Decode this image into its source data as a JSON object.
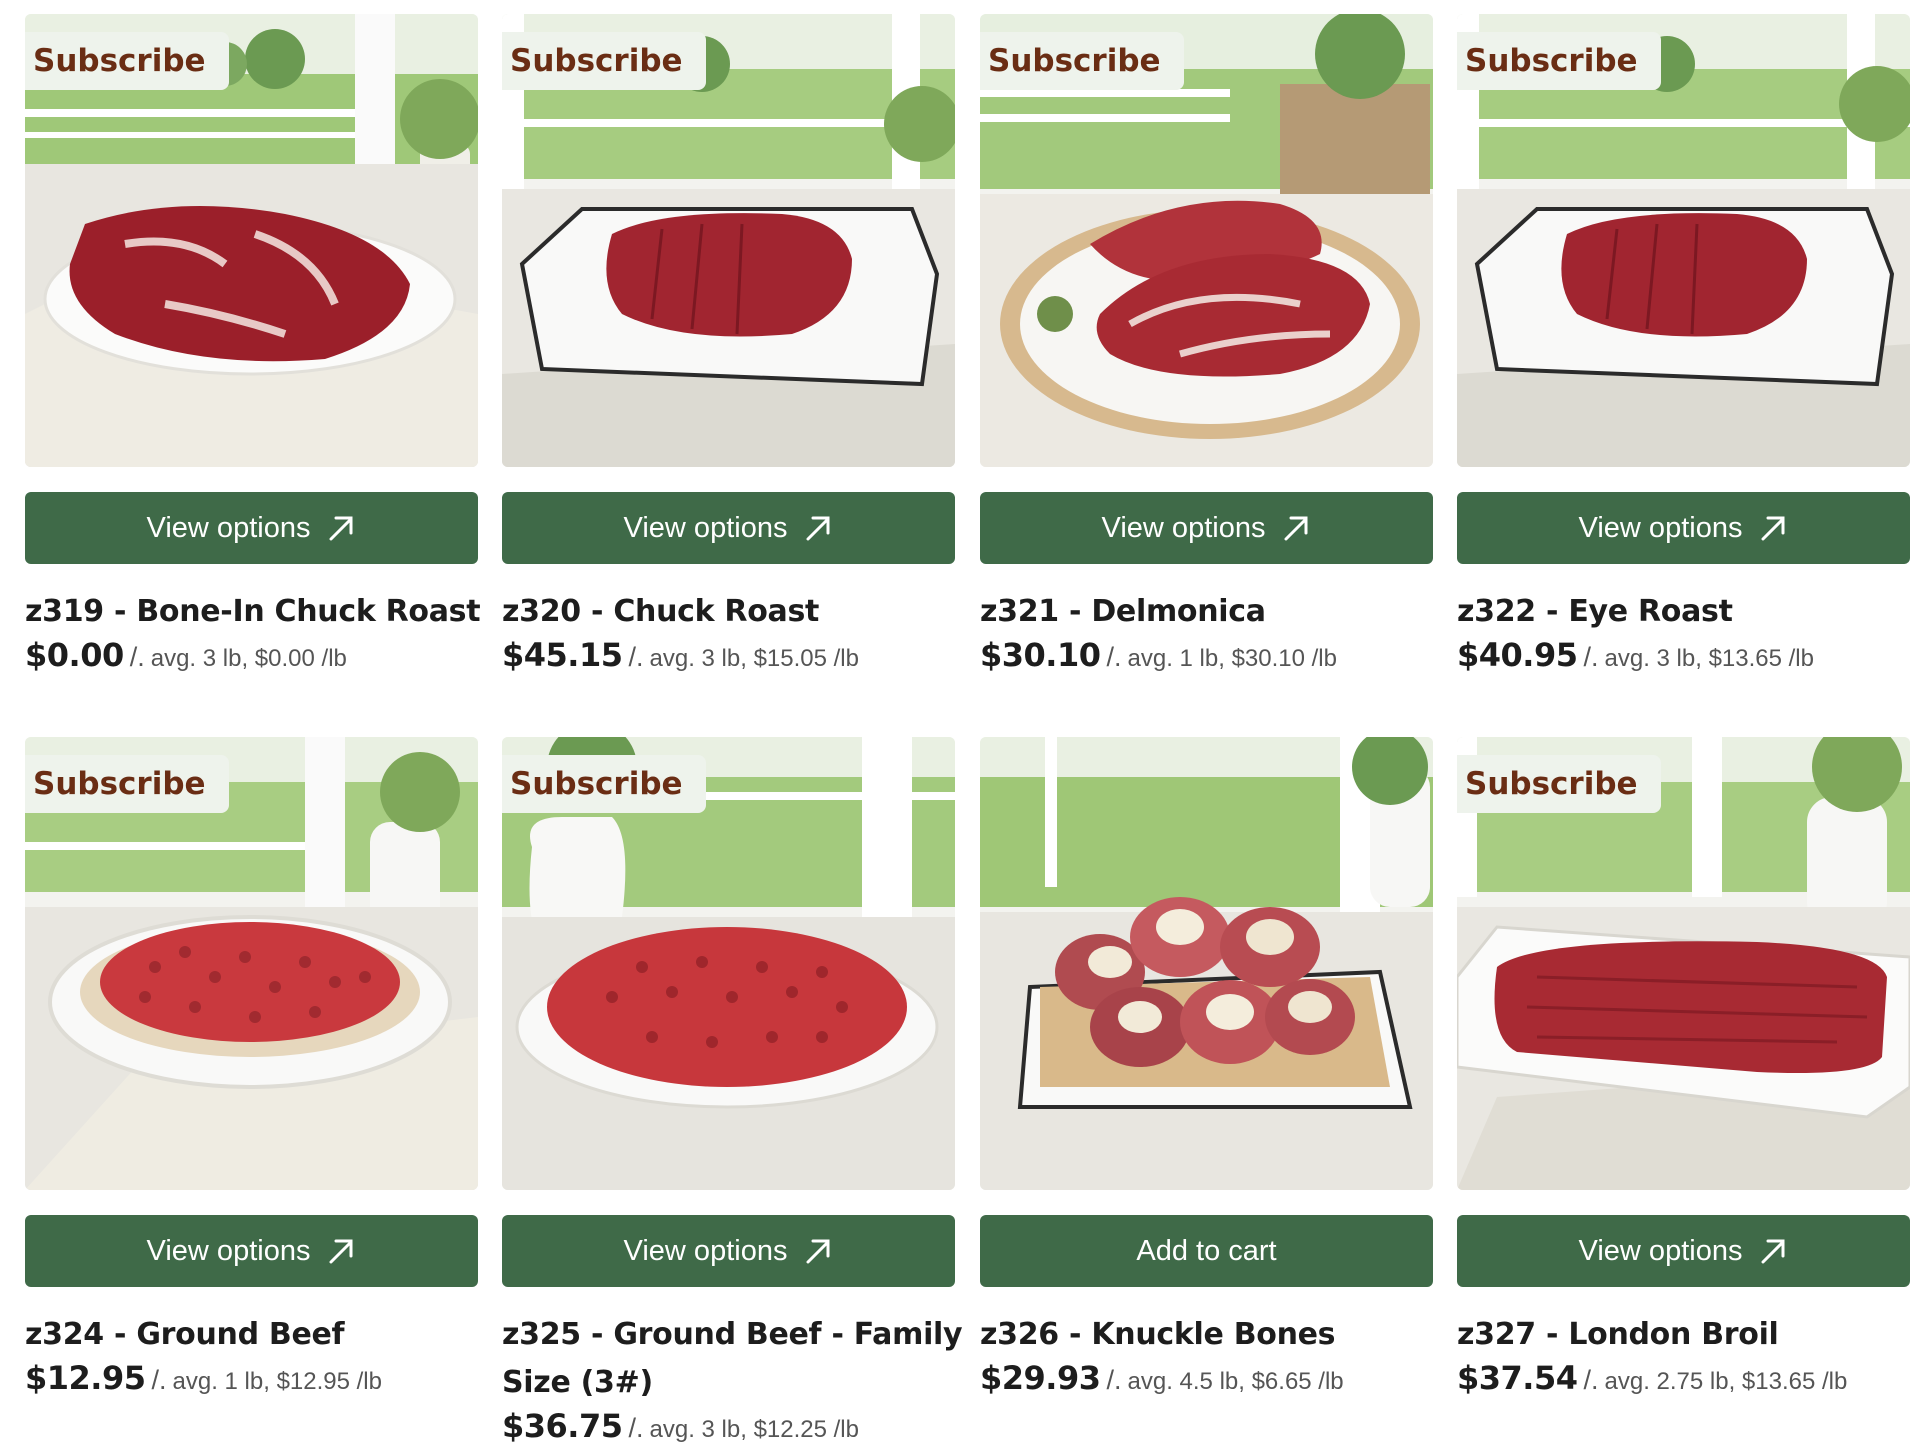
{
  "subscribe_badge": "Subscribe",
  "accent_color": "#3f6a48",
  "badge_text_color": "#6a2d14",
  "products": [
    {
      "badge": "Subscribe",
      "button": "View options",
      "button_icon": "arrow-up-right-icon",
      "title": "z319 - Bone-In Chuck Roast",
      "price": "$0.00",
      "sep": "/.",
      "unit_info": "avg. 3 lb, $0.00 /lb",
      "image": "raw-chuck-roast-on-plate"
    },
    {
      "badge": "Subscribe",
      "button": "View options",
      "button_icon": "arrow-up-right-icon",
      "title": "z320 - Chuck Roast",
      "price": "$45.15",
      "sep": "/.",
      "unit_info": "avg. 3 lb, $15.05 /lb",
      "image": "roast-in-enamel-tray"
    },
    {
      "badge": "Subscribe",
      "button": "View options",
      "button_icon": "arrow-up-right-icon",
      "title": "z321 - Delmonica",
      "price": "$30.10",
      "sep": "/.",
      "unit_info": "avg. 1 lb, $30.10 /lb",
      "image": "ribeye-steaks-on-plate"
    },
    {
      "badge": "Subscribe",
      "button": "View options",
      "button_icon": "arrow-up-right-icon",
      "title": "z322 - Eye Roast",
      "price": "$40.95",
      "sep": "/.",
      "unit_info": "avg. 3 lb, $13.65 /lb",
      "image": "roast-in-enamel-tray"
    },
    {
      "badge": "Subscribe",
      "button": "View options",
      "button_icon": "arrow-up-right-icon",
      "title": "z324 - Ground Beef",
      "price": "$12.95",
      "sep": "/.",
      "unit_info": "avg. 1 lb, $12.95 /lb",
      "image": "ground-beef-in-oval-dish"
    },
    {
      "badge": "Subscribe",
      "button": "View options",
      "button_icon": "arrow-up-right-icon",
      "title": "z325 - Ground Beef - Family Size (3#)",
      "price": "$36.75",
      "sep": "/.",
      "unit_info": "avg. 3 lb, $12.25 /lb",
      "image": "ground-beef-mound-on-plate"
    },
    {
      "badge": "",
      "button": "Add to cart",
      "button_icon": "",
      "title": "z326 - Knuckle Bones",
      "price": "$29.93",
      "sep": "/.",
      "unit_info": "avg. 4.5 lb, $6.65 /lb",
      "image": "knuckle-bones-in-tray"
    },
    {
      "badge": "Subscribe",
      "button": "View options",
      "button_icon": "arrow-up-right-icon",
      "title": "z327 - London Broil",
      "price": "$37.54",
      "sep": "/.",
      "unit_info": "avg. 2.75 lb, $13.65 /lb",
      "image": "london-broil-on-tray"
    }
  ]
}
